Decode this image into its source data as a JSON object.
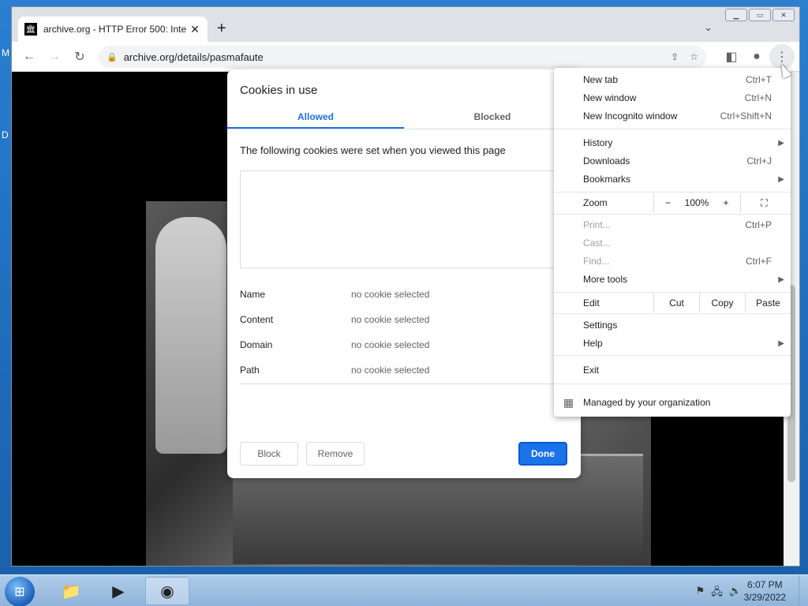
{
  "desktop": {
    "letters": [
      "M",
      "D"
    ]
  },
  "browser": {
    "tab_title": "archive.org - HTTP Error 500: Inte",
    "tab_close": "✕",
    "new_tab": "+",
    "url": "archive.org/details/pasmafaute"
  },
  "dialog": {
    "title": "Cookies in use",
    "tabs": [
      "Allowed",
      "Blocked"
    ],
    "description": "The following cookies were set when you viewed this page",
    "details": [
      {
        "key": "Name",
        "value": "no cookie selected"
      },
      {
        "key": "Content",
        "value": "no cookie selected"
      },
      {
        "key": "Domain",
        "value": "no cookie selected"
      },
      {
        "key": "Path",
        "value": "no cookie selected"
      }
    ],
    "block": "Block",
    "remove": "Remove",
    "done": "Done"
  },
  "menu": {
    "items": [
      {
        "label": "New tab",
        "shortcut": "Ctrl+T"
      },
      {
        "label": "New window",
        "shortcut": "Ctrl+N"
      },
      {
        "label": "New Incognito window",
        "shortcut": "Ctrl+Shift+N"
      },
      {
        "label": "History",
        "shortcut": ""
      },
      {
        "label": "Downloads",
        "shortcut": "Ctrl+J"
      },
      {
        "label": "Bookmarks",
        "shortcut": ""
      },
      {
        "label": "Print...",
        "shortcut": "Ctrl+P"
      },
      {
        "label": "Cast...",
        "shortcut": ""
      },
      {
        "label": "Find...",
        "shortcut": "Ctrl+F"
      },
      {
        "label": "More tools",
        "shortcut": ""
      },
      {
        "label": "Settings",
        "shortcut": ""
      },
      {
        "label": "Help",
        "shortcut": ""
      },
      {
        "label": "Exit",
        "shortcut": ""
      }
    ],
    "zoom": {
      "label": "Zoom",
      "minus": "−",
      "value": "100%",
      "plus": "+"
    },
    "edit": {
      "label": "Edit",
      "cut": "Cut",
      "copy": "Copy",
      "paste": "Paste"
    },
    "managed": "Managed by your organization"
  },
  "taskbar": {
    "time": "6:07 PM",
    "date": "3/29/2022"
  }
}
